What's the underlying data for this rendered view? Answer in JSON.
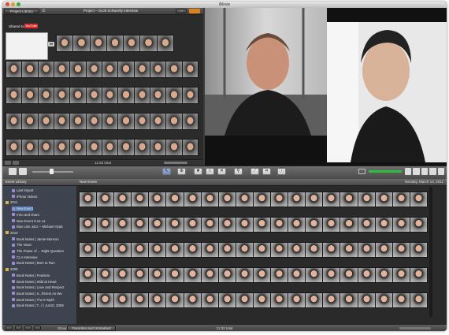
{
  "app": {
    "title": "iMovie"
  },
  "project": {
    "library_button": "Project Library",
    "title": "Project – Scott Schwertly Interview",
    "shared_to_label": "Shared to:",
    "youtube_badge": "YouTube",
    "total": "11:52 total"
  },
  "event_library": {
    "header": "Event Library",
    "items": [
      {
        "label": "Last Import",
        "kind": "item"
      },
      {
        "label": "iPhoto Videos",
        "kind": "item"
      },
      {
        "label": "2011",
        "kind": "year"
      },
      {
        "label": "New Event",
        "kind": "item",
        "selected": true
      },
      {
        "label": "Intro and Outro",
        "kind": "item"
      },
      {
        "label": "New Event 3-14-11",
        "kind": "item"
      },
      {
        "label": "Blue Like Jazz – Michael Hyatt",
        "kind": "item"
      },
      {
        "label": "2010",
        "kind": "year"
      },
      {
        "label": "Book Notes | Jamie Munson",
        "kind": "item"
      },
      {
        "label": "The Noun",
        "kind": "item"
      },
      {
        "label": "The Power of ... Right Question",
        "kind": "item"
      },
      {
        "label": "CLA Interview",
        "kind": "item"
      },
      {
        "label": "Book Notes | Born to Run",
        "kind": "item"
      },
      {
        "label": "2009",
        "kind": "year"
      },
      {
        "label": "Book Notes | Fearless",
        "kind": "item"
      },
      {
        "label": "Book Notes | Wild at Heart",
        "kind": "item"
      },
      {
        "label": "Book Notes | Love and Respect",
        "kind": "item"
      },
      {
        "label": "Book Notes | S...fferent As We",
        "kind": "item"
      },
      {
        "label": "Book Notes | The E-Myth",
        "kind": "item"
      },
      {
        "label": "Book Notes | T...f | Jun10, 2009",
        "kind": "item"
      }
    ]
  },
  "event": {
    "title": "New Event",
    "date": "Monday, March 14, 2011",
    "total": "11:32 total",
    "show_label": "Show:",
    "show_value": "Favorites and Unmarked"
  },
  "colors": {
    "selection_orange": "#d9821f",
    "selected_item": "#5c7fb8",
    "youtube_red": "#d32f2f"
  }
}
